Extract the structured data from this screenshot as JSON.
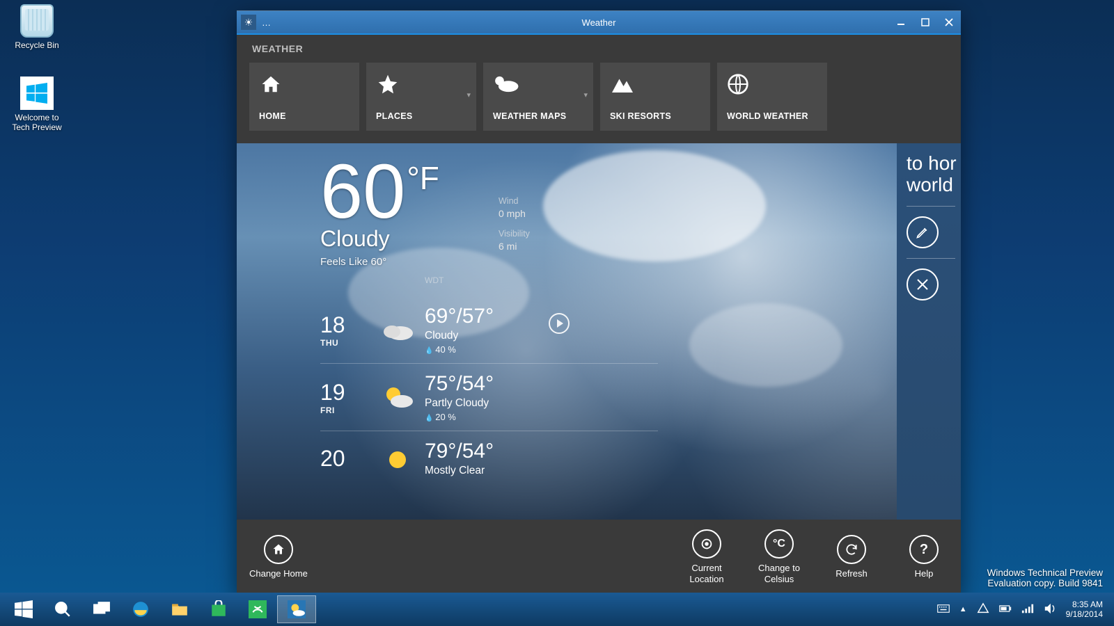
{
  "desktop": {
    "icons": [
      {
        "label": "Recycle Bin"
      },
      {
        "label": "Welcome to\nTech Preview"
      }
    ]
  },
  "window": {
    "title": "Weather",
    "menu_indicator": "…",
    "section_label": "WEATHER"
  },
  "tiles": [
    {
      "label": "HOME",
      "dropdown": false
    },
    {
      "label": "PLACES",
      "dropdown": true
    },
    {
      "label": "WEATHER MAPS",
      "dropdown": true
    },
    {
      "label": "SKI RESORTS",
      "dropdown": false
    },
    {
      "label": "WORLD WEATHER",
      "dropdown": false
    }
  ],
  "current": {
    "temp": "60",
    "unit": "°F",
    "condition": "Cloudy",
    "feels": "Feels Like 60°",
    "wind_label": "Wind",
    "wind_value": "0 mph",
    "visibility_label": "Visibility",
    "visibility_value": "6 mi",
    "attribution": "WDT"
  },
  "forecast": [
    {
      "date": "18",
      "dow": "THU",
      "hi_lo": "69°/57°",
      "cond": "Cloudy",
      "precip": "40 %",
      "icon": "cloud"
    },
    {
      "date": "19",
      "dow": "FRI",
      "hi_lo": "75°/54°",
      "cond": "Partly Cloudy",
      "precip": "20 %",
      "icon": "suncloud"
    },
    {
      "date": "20",
      "dow": "",
      "hi_lo": "79°/54°",
      "cond": "Mostly Clear",
      "precip": "",
      "icon": "sun"
    }
  ],
  "sidepanel": {
    "line1": "to hor",
    "line2": "world"
  },
  "bottombar": [
    {
      "id": "change-home",
      "label": "Change Home",
      "icon": "home"
    },
    {
      "id": "current-location",
      "label": "Current\nLocation",
      "icon": "target"
    },
    {
      "id": "change-celsius",
      "label": "Change to\nCelsius",
      "icon": "celsius"
    },
    {
      "id": "refresh",
      "label": "Refresh",
      "icon": "refresh"
    },
    {
      "id": "help",
      "label": "Help",
      "icon": "help"
    }
  ],
  "watermark": {
    "line1": "Windows Technical Preview",
    "line2": "Evaluation copy. Build 9841"
  },
  "tray": {
    "time": "8:35 AM",
    "date": "9/18/2014"
  }
}
